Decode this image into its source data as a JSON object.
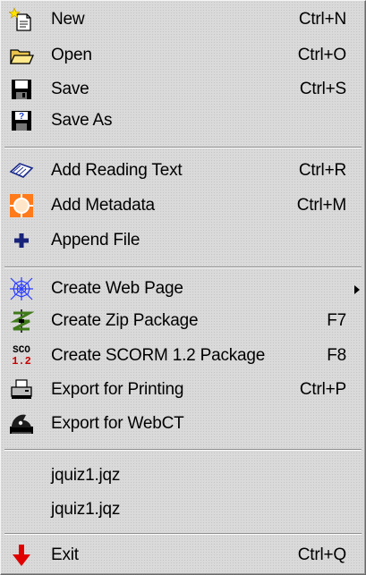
{
  "menu": {
    "items": [
      {
        "label": "New",
        "shortcut": "Ctrl+N",
        "icon": "new-file-icon"
      },
      {
        "label": "Open",
        "shortcut": "Ctrl+O",
        "icon": "open-folder-icon"
      },
      {
        "label": "Save",
        "shortcut": "Ctrl+S",
        "icon": "save-disk-icon"
      },
      {
        "label": "Save As",
        "shortcut": "",
        "icon": "save-as-disk-icon"
      },
      {
        "label": "Add Reading Text",
        "shortcut": "Ctrl+R",
        "icon": "reading-book-icon"
      },
      {
        "label": "Add Metadata",
        "shortcut": "Ctrl+M",
        "icon": "metadata-icon"
      },
      {
        "label": "Append File",
        "shortcut": "",
        "icon": "plus-icon"
      },
      {
        "label": "Create Web Page",
        "shortcut": "",
        "icon": "web-icon"
      },
      {
        "label": "Create Zip Package",
        "shortcut": "F7",
        "icon": "zip-icon"
      },
      {
        "label": "Create SCORM 1.2 Package",
        "shortcut": "F8",
        "icon": "scorm-icon",
        "icon_text_top": "SCO",
        "icon_text_bottom": "1.2"
      },
      {
        "label": "Export for Printing",
        "shortcut": "Ctrl+P",
        "icon": "printer-icon"
      },
      {
        "label": "Export for WebCT",
        "shortcut": "",
        "icon": "webct-icon"
      },
      {
        "label": "jquiz1.jqz",
        "shortcut": ""
      },
      {
        "label": "jquiz1.jqz",
        "shortcut": ""
      },
      {
        "label": "Exit",
        "shortcut": "Ctrl+Q",
        "icon": "exit-arrow-icon"
      }
    ]
  }
}
